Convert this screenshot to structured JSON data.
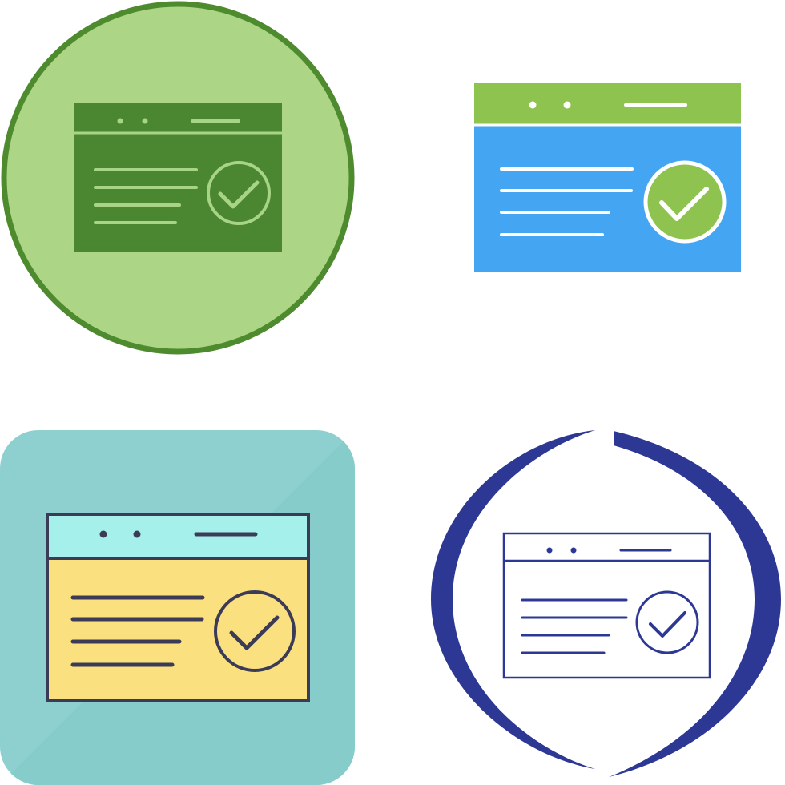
{
  "icons": [
    {
      "style": "flat-circle-green",
      "name": "browser-checkmark-icon",
      "colors": {
        "background": "#acd585",
        "ring": "#4e8b2e",
        "window": "#4b8730",
        "detail": "#a8d488"
      }
    },
    {
      "style": "flat-color",
      "name": "browser-checkmark-icon",
      "colors": {
        "header": "#8dc34e",
        "body": "#44a6f2",
        "detail": "#ffffff",
        "check_circle": "#8dc34e"
      }
    },
    {
      "style": "filled-outline-rounded-square",
      "name": "browser-checkmark-icon",
      "colors": {
        "background": "#8dd0cf",
        "header": "#a6f0ec",
        "body": "#fbe07f",
        "outline": "#3b3b57"
      }
    },
    {
      "style": "line-ring",
      "name": "browser-checkmark-icon",
      "colors": {
        "ring": "#2c3894",
        "outline": "#2c3894"
      }
    }
  ]
}
